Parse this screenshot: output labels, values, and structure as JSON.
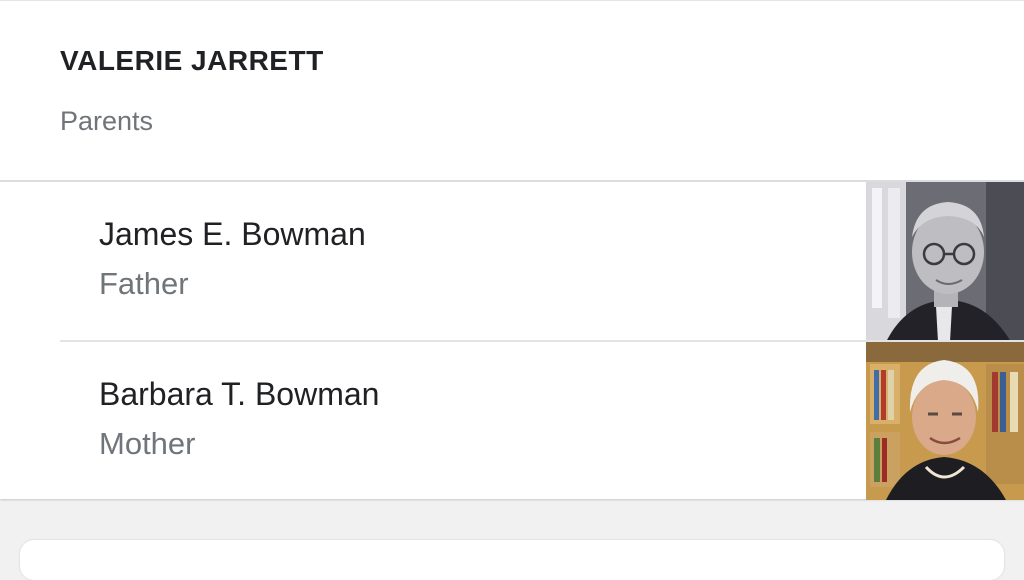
{
  "header": {
    "title": "VALERIE JARRETT",
    "subtitle": "Parents"
  },
  "parents": [
    {
      "name": "James E. Bowman",
      "relation": "Father",
      "photo_icon": "person-photo"
    },
    {
      "name": "Barbara T. Bowman",
      "relation": "Mother",
      "photo_icon": "person-photo"
    }
  ],
  "colors": {
    "title": "#202124",
    "secondary_text": "#70757a",
    "divider": "#dadce0",
    "background": "#f1f1f1"
  }
}
